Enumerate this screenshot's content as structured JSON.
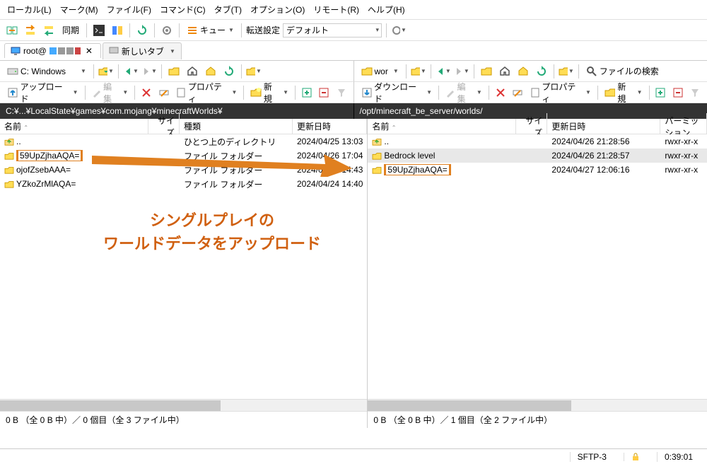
{
  "menu": [
    "ローカル(L)",
    "マーク(M)",
    "ファイル(F)",
    "コマンド(C)",
    "タブ(T)",
    "オプション(O)",
    "リモート(R)",
    "ヘルプ(H)"
  ],
  "tb1": {
    "sync": "同期",
    "queue": "キュー",
    "transfer_label": "転送設定",
    "transfer_value": "デフォルト"
  },
  "tabs": {
    "session": "root@",
    "newtab": "新しいタブ"
  },
  "tb2_right": {
    "findfiles": "ファイルの検索"
  },
  "leftpath": {
    "drive": "C: Windows"
  },
  "leftact": {
    "upload": "アップロード",
    "edit": "編集",
    "props": "プロパティ",
    "newm": "新規"
  },
  "rightpath": {
    "drive": "wor"
  },
  "rightact": {
    "download": "ダウンロード",
    "edit": "編集",
    "props": "プロパティ",
    "newm": "新規"
  },
  "left": {
    "path": "C:¥...¥LocalState¥games¥com.mojang¥minecraftWorlds¥",
    "cols": [
      "名前",
      "サイズ",
      "種類",
      "更新日時"
    ],
    "rows": [
      {
        "name": "..",
        "type": "ひとつ上のディレクトリ",
        "date": "2024/04/25 13:03",
        "up": true
      },
      {
        "name": "59UpZjhaAQA=",
        "type": "ファイル フォルダー",
        "date": "2024/04/26 17:04",
        "hl": true
      },
      {
        "name": "ojofZsebAAA=",
        "type": "ファイル フォルダー",
        "date": "2024/04/22 14:43"
      },
      {
        "name": "YZkoZrMlAQA=",
        "type": "ファイル フォルダー",
        "date": "2024/04/24 14:40"
      }
    ],
    "status": "0 B （全 0 B 中）／ 0 個目（全 3 ファイル中）"
  },
  "right": {
    "path": "/opt/minecraft_be_server/worlds/",
    "cols": [
      "名前",
      "サイズ",
      "更新日時",
      "パーミッション"
    ],
    "rows": [
      {
        "name": "..",
        "date": "2024/04/26 21:28:56",
        "perm": "rwxr-xr-x",
        "up": true
      },
      {
        "name": "Bedrock level",
        "date": "2024/04/26 21:28:57",
        "perm": "rwxr-xr-x",
        "sel": true
      },
      {
        "name": "59UpZjhaAQA=",
        "date": "2024/04/27 12:06:16",
        "perm": "rwxr-xr-x",
        "hl": true
      }
    ],
    "status": "0 B （全 0 B 中）／ 1 個目（全 2 ファイル中）"
  },
  "annot": {
    "l1": "シングルプレイの",
    "l2": "ワールドデータをアップロード"
  },
  "footer": {
    "proto": "SFTP-3",
    "time": "0:39:01"
  }
}
